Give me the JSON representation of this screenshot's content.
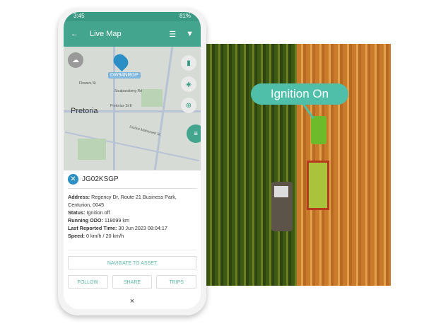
{
  "status_bar": {
    "time": "3:45",
    "battery": "81%"
  },
  "app": {
    "title": "Live Map"
  },
  "map": {
    "city": "Pretoria",
    "asset_label": "DW94NRGP",
    "streets": [
      "Flowers St",
      "Soutpansberg Rd",
      "Pretorius St E",
      "Justice Mahomed St"
    ]
  },
  "asset": {
    "name": "JG02KSGP",
    "fields": [
      {
        "label": "Address:",
        "value": "Regency Dr, Route 21 Business Park, Centurion, 0045"
      },
      {
        "label": "Status:",
        "value": "Ignition off"
      },
      {
        "label": "Running ODO:",
        "value": "118099 km"
      },
      {
        "label": "Last Reported Time:",
        "value": "30 Jun 2023 08:04:17"
      },
      {
        "label": "Speed:",
        "value": "0 km/h / 20 km/h"
      }
    ]
  },
  "buttons": {
    "navigate": "NAVIGATE TO ASSET",
    "follow": "FOLLOW",
    "share": "SHARE",
    "trips": "TRIPS",
    "close": "×"
  },
  "photo": {
    "callout": "Ignition On"
  }
}
